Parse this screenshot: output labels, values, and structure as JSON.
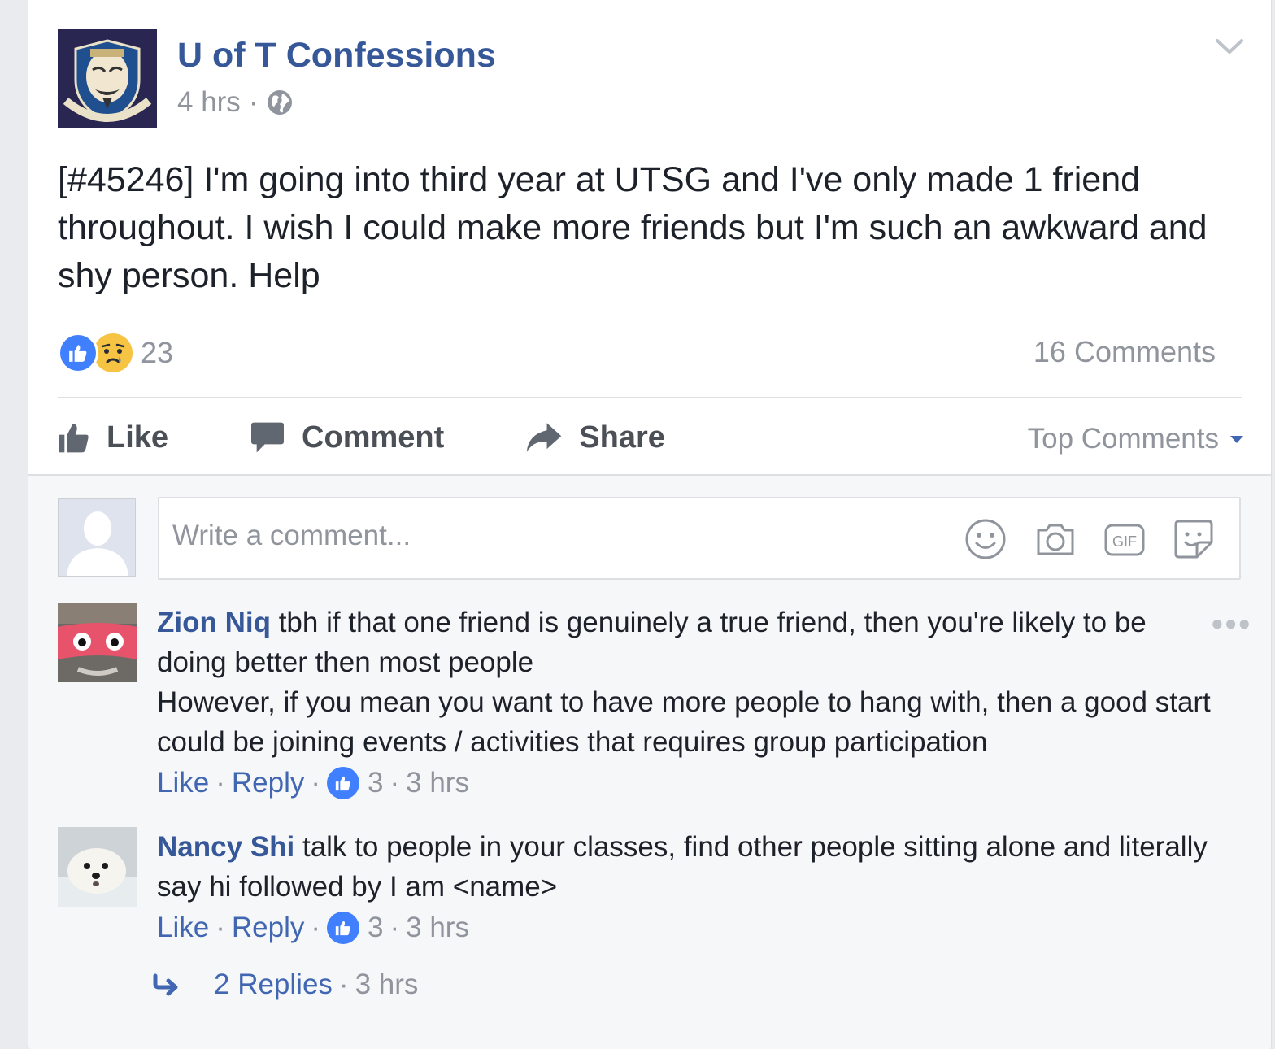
{
  "post": {
    "page_name": "U of T Confessions",
    "time": "4 hrs",
    "meta_dot": "·",
    "privacy_icon": "globe-icon",
    "text": "[#45246] I'm going into third year at UTSG and I've only made 1 friend throughout. I wish I could make more friends but I'm such an awkward and shy person. Help",
    "reactions": {
      "types": [
        "like",
        "sad"
      ],
      "count": "23"
    },
    "comments_count": "16 Comments"
  },
  "actions": {
    "like_label": "Like",
    "comment_label": "Comment",
    "share_label": "Share",
    "sort_label": "Top Comments"
  },
  "composer": {
    "placeholder": "Write a comment...",
    "gif_label": "GIF",
    "icons": [
      "emoji-icon",
      "camera-icon",
      "gif-icon",
      "sticker-icon"
    ]
  },
  "comments": [
    {
      "author": "Zion Niq",
      "text": "tbh if that one friend is genuinely a true friend, then you're likely to be doing better then most people",
      "text2": "However, if you mean you want to have more people to hang with, then a good start could be joining events / activities that requires group participation",
      "like_label": "Like",
      "reply_label": "Reply",
      "sep": "·",
      "likes": "3",
      "time": "3 hrs"
    },
    {
      "author": "Nancy Shi",
      "text": "talk to people in your classes, find other people sitting alone and literally say hi followed by I am <name>",
      "like_label": "Like",
      "reply_label": "Reply",
      "sep": "·",
      "likes": "3",
      "time": "3 hrs",
      "replies_label": "2 Replies",
      "replies_time": "3 hrs"
    }
  ],
  "colors": {
    "link": "#365899",
    "accent": "#4267b2",
    "like_blue": "#4080ff",
    "muted": "#90949c",
    "sad_yellow": "#f7c343"
  }
}
